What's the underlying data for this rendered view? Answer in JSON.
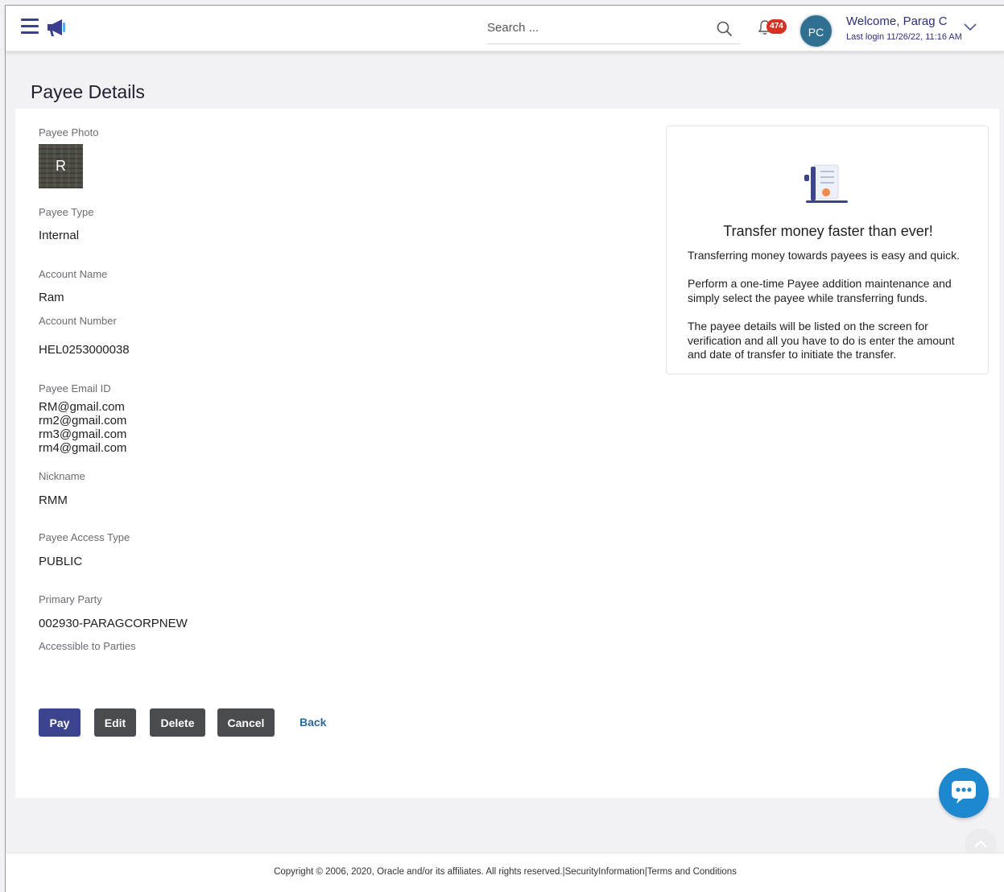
{
  "header": {
    "search_placeholder": "Search ...",
    "notification_count": "474",
    "user_initials": "PC",
    "welcome": "Welcome, Parag C",
    "last_login": "Last login 11/26/22, 11:16 AM"
  },
  "page": {
    "title": "Payee Details"
  },
  "details": {
    "photo_label": "Payee Photo",
    "photo_initial": "R",
    "payee_type_label": "Payee Type",
    "payee_type": "Internal",
    "account_name_label": "Account Name",
    "account_name": "Ram",
    "account_number_label": "Account Number",
    "account_number": "HEL0253000038",
    "email_label": "Payee Email ID",
    "emails": [
      "RM@gmail.com",
      "rm2@gmail.com",
      "rm3@gmail.com",
      "rm4@gmail.com"
    ],
    "nickname_label": "Nickname",
    "nickname": "RMM",
    "access_type_label": "Payee Access Type",
    "access_type": "PUBLIC",
    "primary_party_label": "Primary Party",
    "primary_party": "002930-PARAGCORPNEW",
    "accessible_parties_label": "Accessible to Parties"
  },
  "actions": {
    "pay": "Pay",
    "edit": "Edit",
    "delete": "Delete",
    "cancel": "Cancel",
    "back": "Back"
  },
  "info": {
    "title": "Transfer money faster than ever!",
    "para1": "Transferring money towards payees is easy and quick.",
    "para2": "Perform a one-time Payee addition maintenance and simply select the payee while transferring funds.",
    "para3": "The payee details will be listed on the screen for verification and all you have to do is enter the amount and date of transfer to initiate the transfer."
  },
  "footer": {
    "copyright": "Copyright © 2006, 2020, Oracle and/or its affiliates. All rights reserved.",
    "security": "SecurityInformation",
    "terms": "Terms and Conditions"
  },
  "colors": {
    "brand": "#3c448f",
    "badge": "#d93025",
    "chat": "#1e88cf",
    "link": "#2a6a9b"
  }
}
